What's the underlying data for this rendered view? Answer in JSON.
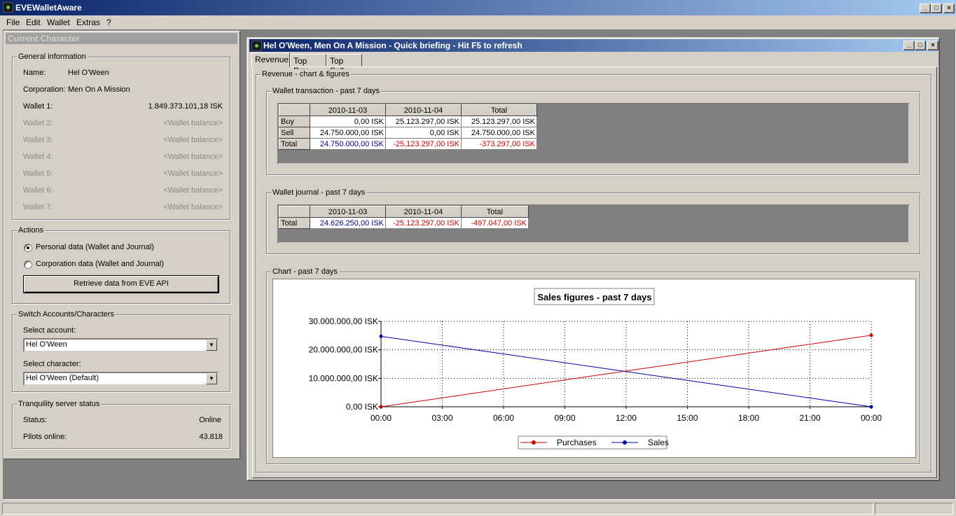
{
  "app": {
    "title": "EVEWalletAware",
    "menu": [
      "File",
      "Edit",
      "Wallet",
      "Extras",
      "?"
    ]
  },
  "panel": {
    "title": "Current Character",
    "general": {
      "legend": "General information",
      "name_label": "Name:",
      "name": "Hel O'Ween",
      "corp_label": "Corporation:",
      "corp": "Men On A Mission",
      "wallets": [
        {
          "label": "Wallet 1:",
          "value": "1.849.373.101,18 ISK"
        },
        {
          "label": "Wallet 2:",
          "value": "<Wallet balance>"
        },
        {
          "label": "Wallet 3:",
          "value": "<Wallet balance>"
        },
        {
          "label": "Wallet 4:",
          "value": "<Wallet balance>"
        },
        {
          "label": "Wallet 5:",
          "value": "<Wallet balance>"
        },
        {
          "label": "Wallet 6:",
          "value": "<Wallet balance>"
        },
        {
          "label": "Wallet 7:",
          "value": "<Wallet balance>"
        }
      ]
    },
    "actions": {
      "legend": "Actions",
      "radio_personal": "Personal data (Wallet and Journal)",
      "radio_corp": "Corporation data (Wallet and Journal)",
      "button": "Retrieve data from EVE API"
    },
    "switch": {
      "legend": "Switch Accounts/Characters",
      "account_label": "Select account:",
      "account": "Hel O'Ween",
      "character_label": "Select character:",
      "character": "Hel O'Ween (Default)"
    },
    "server": {
      "legend": "Tranquility server status",
      "status_label": "Status:",
      "status": "Online",
      "pilots_label": "Pilots online:",
      "pilots": "43.818"
    }
  },
  "child": {
    "title": "Hel O'Ween, Men On A Mission - Quick briefing - Hit F5 to refresh",
    "tabs": [
      "Revenue",
      "Top Buy",
      "Top Sell"
    ],
    "revenue_legend": "Revenue - chart & figures",
    "transactions": {
      "legend": "Wallet transaction - past 7 days",
      "headers": [
        "2010-11-03",
        "2010-11-04",
        "Total"
      ],
      "rows": [
        {
          "label": "Buy",
          "cells": [
            "0,00 ISK",
            "25.123.297,00 ISK",
            "25.123.297,00 ISK"
          ]
        },
        {
          "label": "Sell",
          "cells": [
            "24.750.000,00 ISK",
            "0,00 ISK",
            "24.750.000,00 ISK"
          ]
        },
        {
          "label": "Total",
          "cells": [
            "24.750.000,00 ISK",
            "-25.123.297,00 ISK",
            "-373.297,00 ISK"
          ]
        }
      ]
    },
    "journal": {
      "legend": "Wallet journal - past 7 days",
      "headers": [
        "2010-11-03",
        "2010-11-04",
        "Total"
      ],
      "rows": [
        {
          "label": "Total",
          "cells": [
            "24.626.250,00 ISK",
            "-25.123.297,00 ISK",
            "-497.047,00 ISK"
          ]
        }
      ]
    },
    "chart_legend": "Chart - past 7 days"
  },
  "chart_data": {
    "type": "line",
    "title": "Sales figures - past 7 days",
    "x_ticks": [
      "00:00",
      "03:00",
      "06:00",
      "09:00",
      "12:00",
      "15:00",
      "18:00",
      "21:00",
      "00:00"
    ],
    "y_ticks": [
      "0,00 ISK",
      "10.000.000,00 ISK",
      "20.000.000,00 ISK",
      "30.000.000,00 ISK"
    ],
    "ylim": [
      0,
      30000000
    ],
    "grid": true,
    "legend": "bottom",
    "series": [
      {
        "name": "Purchases",
        "color": "#cc0000",
        "x": [
          0,
          1
        ],
        "values": [
          0,
          25123297
        ]
      },
      {
        "name": "Sales",
        "color": "#0000aa",
        "x": [
          0,
          1
        ],
        "values": [
          24750000,
          0
        ]
      }
    ]
  }
}
